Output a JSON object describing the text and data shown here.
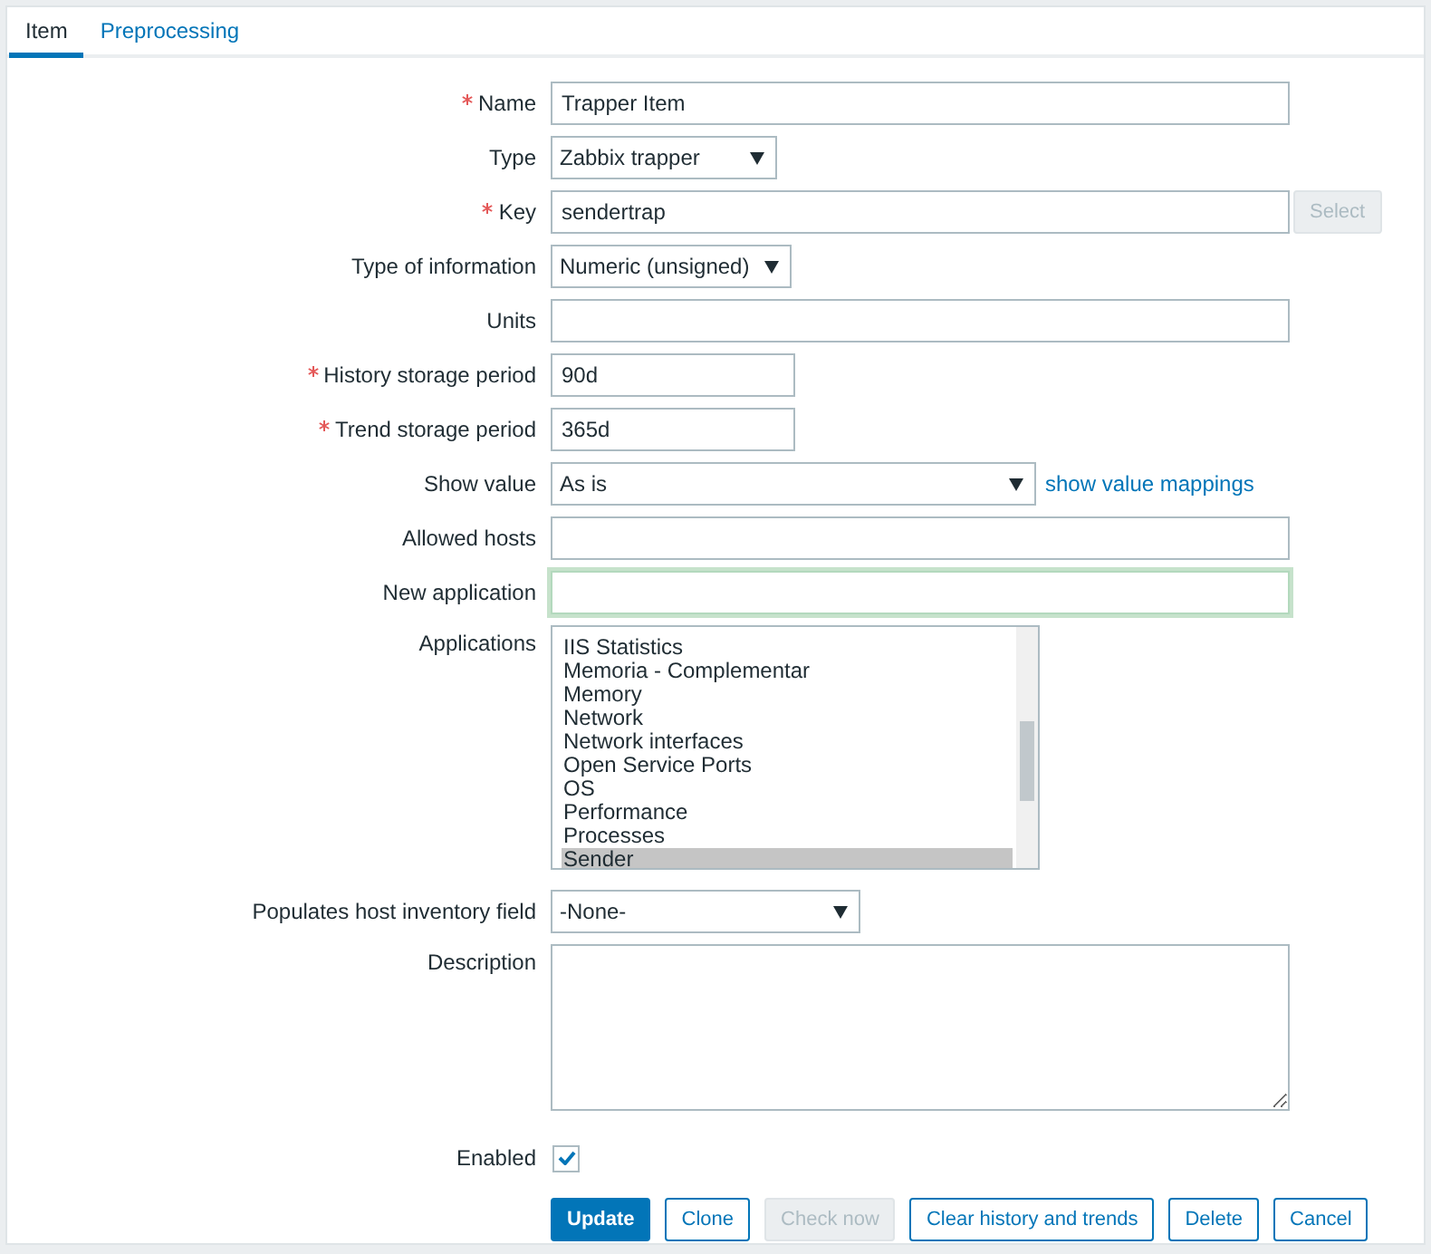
{
  "tabs": [
    {
      "label": "Item",
      "selected": true
    },
    {
      "label": "Preprocessing",
      "selected": false
    }
  ],
  "fields": [
    {
      "kind": "text",
      "label": "Name",
      "required": true,
      "value": "Trapper Item"
    },
    {
      "kind": "select",
      "label": "Type",
      "required": false,
      "value": "Zabbix trapper"
    },
    {
      "kind": "text",
      "label": "Key",
      "required": true,
      "value": "sendertrap",
      "button": {
        "label": "Select",
        "disabled": true
      }
    },
    {
      "kind": "select",
      "label": "Type of information",
      "required": false,
      "value": "Numeric (unsigned)"
    },
    {
      "kind": "text",
      "label": "Units",
      "required": false
    },
    {
      "kind": "text",
      "label": "History storage period",
      "required": true,
      "value": "90d"
    },
    {
      "kind": "text",
      "label": "Trend storage period",
      "required": true,
      "value": "365d"
    },
    {
      "kind": "select",
      "label": "Show value",
      "required": false,
      "value": "As is",
      "link": "show value mappings"
    },
    {
      "kind": "text",
      "label": "Allowed hosts",
      "required": false
    },
    {
      "kind": "text",
      "label": "New application",
      "required": false,
      "focused": true
    },
    {
      "kind": "listbox",
      "label": "Applications",
      "required": false,
      "options": [
        {
          "label": "IIS Statistics",
          "selected": false
        },
        {
          "label": "Memoria - Complementar",
          "selected": false
        },
        {
          "label": "Memory",
          "selected": false
        },
        {
          "label": "Network",
          "selected": false
        },
        {
          "label": "Network interfaces",
          "selected": false
        },
        {
          "label": "Open Service Ports",
          "selected": false
        },
        {
          "label": "OS",
          "selected": false
        },
        {
          "label": "Performance",
          "selected": false
        },
        {
          "label": "Processes",
          "selected": false
        },
        {
          "label": "Sender",
          "selected": true
        }
      ]
    },
    {
      "kind": "select",
      "label": "Populates host inventory field",
      "required": false,
      "value": "-None-"
    },
    {
      "kind": "textarea",
      "label": "Description",
      "required": false
    },
    {
      "kind": "checkbox",
      "label": "Enabled",
      "required": false,
      "checked": true
    }
  ],
  "buttons": [
    {
      "label": "Update",
      "primary": true,
      "disabled": false
    },
    {
      "label": "Clone",
      "primary": false,
      "disabled": false
    },
    {
      "label": "Check now",
      "primary": false,
      "disabled": true
    },
    {
      "label": "Clear history and trends",
      "primary": false,
      "disabled": false
    },
    {
      "label": "Delete",
      "primary": false,
      "disabled": false
    },
    {
      "label": "Cancel",
      "primary": false,
      "disabled": false
    }
  ]
}
